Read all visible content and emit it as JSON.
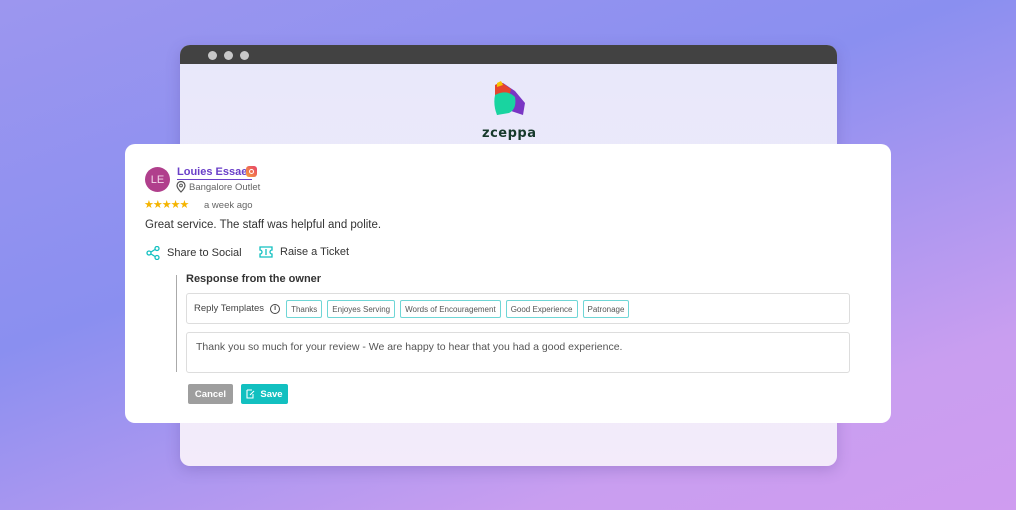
{
  "brand": {
    "name": "zceppa"
  },
  "review": {
    "avatar_initials": "LE",
    "avatar_color": "#b03f8c",
    "reviewer_name": "Louies Essaer",
    "source": "instagram-icon",
    "location": "Bangalore Outlet",
    "rating": 5,
    "stars": "★★★★★",
    "time": "a week ago",
    "text": "Great service. The staff was helpful and polite."
  },
  "actions": {
    "share": "Share to Social",
    "ticket": "Raise a Ticket"
  },
  "response": {
    "heading": "Response from the owner",
    "templates_label": "Reply Templates",
    "templates": [
      "Thanks",
      "Enjoyes Serving",
      "Words of Encouragement",
      "Good Experience",
      "Patronage"
    ],
    "reply_text": "Thank you so much for your review - We are happy to hear that you had a good experience.",
    "cancel": "Cancel",
    "save": "Save"
  },
  "colors": {
    "accent": "#12c0c0",
    "name": "#6a3fc8",
    "star": "#f5b400",
    "cancel": "#9e9e9e"
  }
}
